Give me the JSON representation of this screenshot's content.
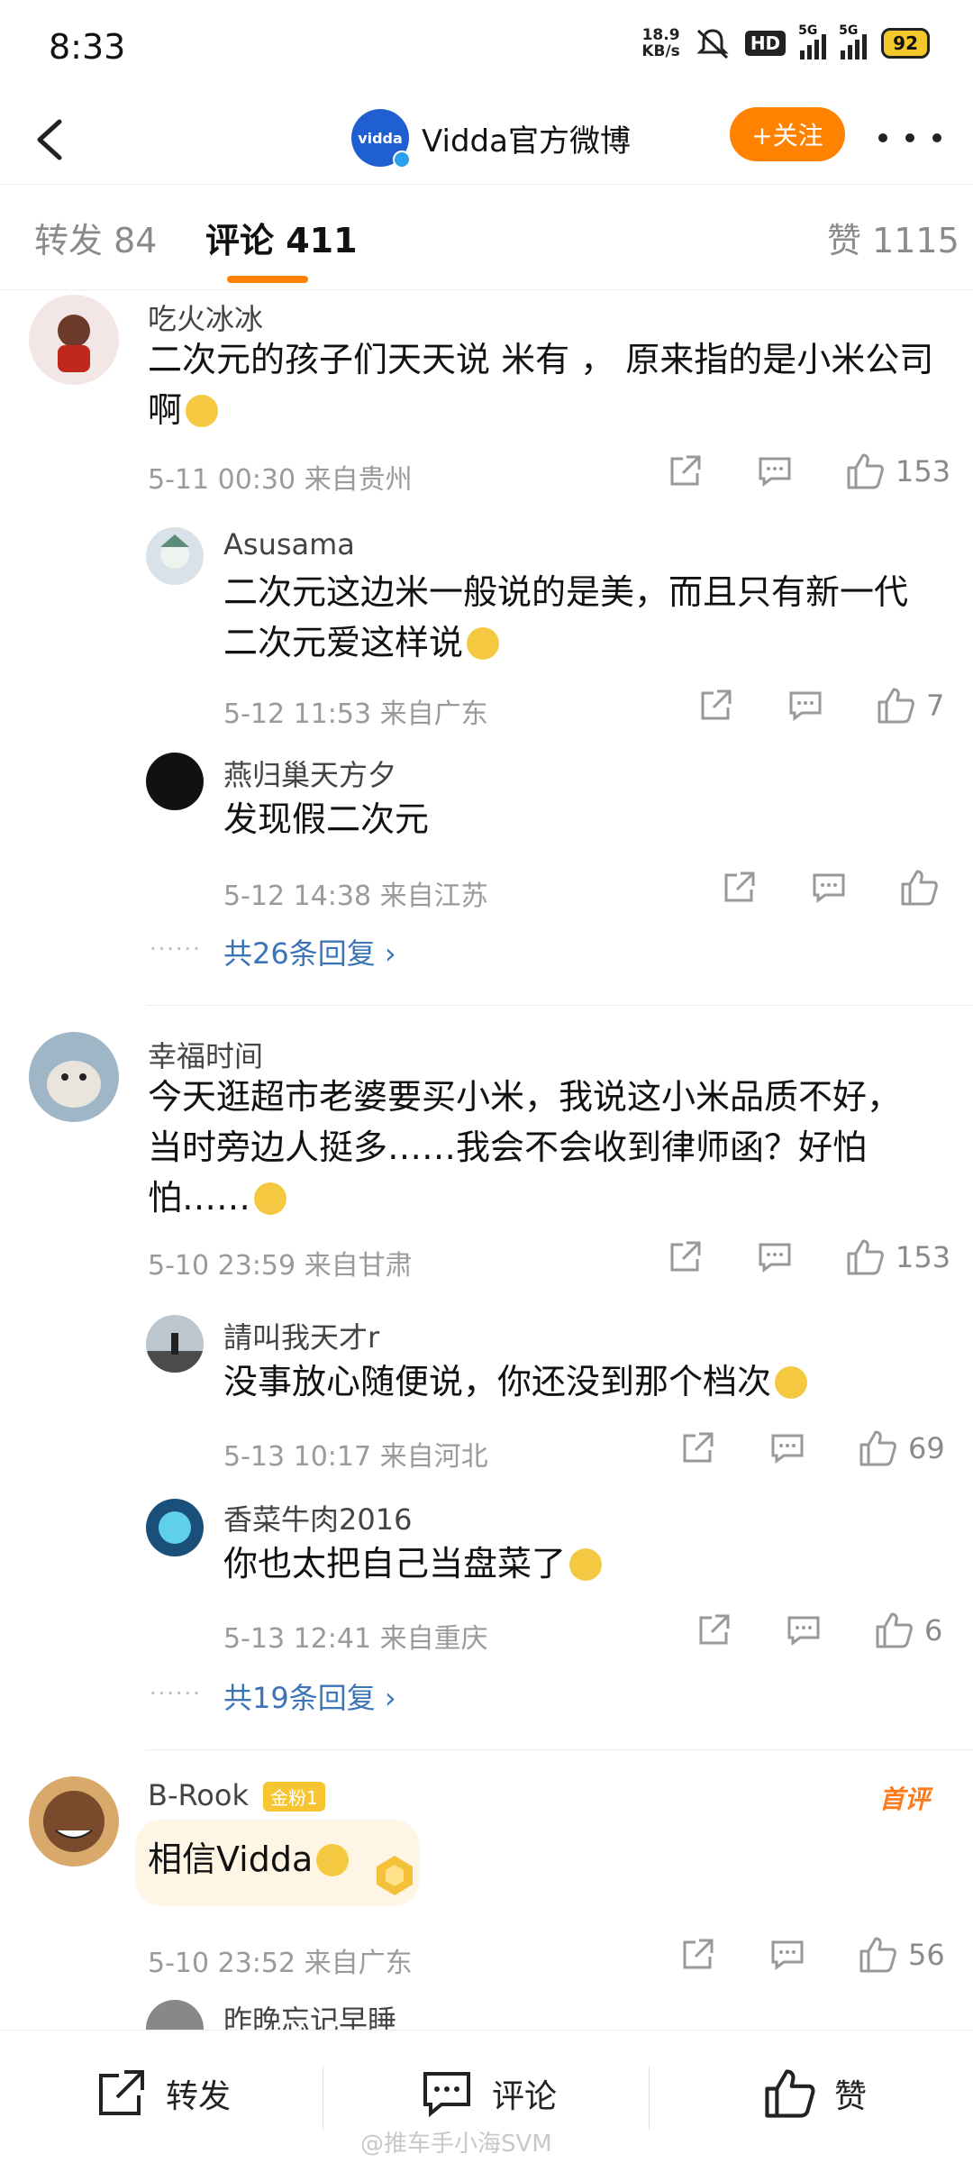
{
  "status_bar": {
    "time": "8:33",
    "speed": "18.9",
    "speed_unit": "KB/s",
    "hd": "HD",
    "net1": "5G",
    "net2": "5G",
    "battery": "92"
  },
  "header": {
    "avatar_text": "vidda",
    "title": "Vidda官方微博",
    "follow": "+关注"
  },
  "tabs": {
    "repost": "转发 84",
    "comment": "评论 411",
    "like": "赞 1115"
  },
  "comments": [
    {
      "user": "吃火冰冰",
      "text_line1": "二次元的孩子们天天说 米有 ， 原来指的是小米公司",
      "text_line2": "啊",
      "meta": "5-11 00:30  来自贵州",
      "likes": "153",
      "replies": [
        {
          "user": "Asusama",
          "text_line1": "二次元这边米一般说的是美，而且只有新一代",
          "text_line2": "二次元爱这样说",
          "meta": "5-12 11:53  来自广东",
          "likes": "7"
        },
        {
          "user": "燕归巢天方夕",
          "text_line1": "发现假二次元",
          "meta": "5-12 14:38  来自江苏",
          "likes": ""
        }
      ],
      "more_replies": "共26条回复 ›"
    },
    {
      "user": "幸福时间",
      "text_line1": "今天逛超市老婆要买小米，我说这小米品质不好，",
      "text_line2": "当时旁边人挺多……我会不会收到律师函？好怕",
      "text_line3": "怕……",
      "meta": "5-10 23:59  来自甘肃",
      "likes": "153",
      "replies": [
        {
          "user": "請叫我天才r",
          "text_line1": "没事放心随便说，你还没到那个档次",
          "meta": "5-13 10:17  来自河北",
          "likes": "69"
        },
        {
          "user": "香菜牛肉2016",
          "text_line1": "你也太把自己当盘菜了",
          "meta": "5-13 12:41  来自重庆",
          "likes": "6"
        }
      ],
      "more_replies": "共19条回复 ›"
    },
    {
      "user": "B-Rook",
      "badge": "金粉1",
      "first_tag": "首评",
      "text_line1": "相信Vidda",
      "meta": "5-10 23:52  来自广东",
      "likes": "56",
      "next_reply_user": "昨晚忘记早睡"
    }
  ],
  "bottom_bar": {
    "repost": "转发",
    "comment": "评论",
    "like": "赞",
    "watermark": "@推车手小海SVM"
  },
  "colors": {
    "accent": "#ff8200",
    "link": "#3b74b8"
  }
}
